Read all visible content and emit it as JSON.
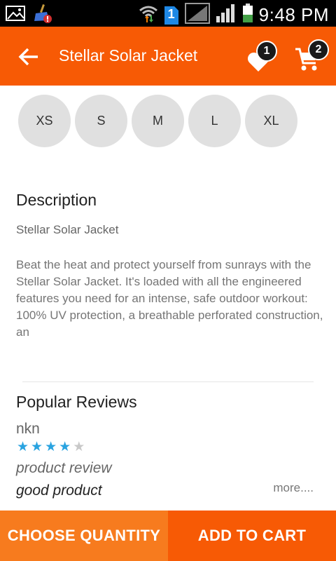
{
  "status_bar": {
    "time": "9:48 PM",
    "sim_badge": "1",
    "icons": [
      "image-icon",
      "broom-icon",
      "wifi-icon",
      "sim-icon",
      "signal-icon",
      "battery-icon"
    ]
  },
  "app_bar": {
    "title": "Stellar Solar Jacket",
    "wishlist_count": "1",
    "cart_count": "2",
    "accent_color": "#f75a05"
  },
  "sizes": [
    "XS",
    "S",
    "M",
    "L",
    "XL"
  ],
  "description": {
    "heading": "Description",
    "subtitle": "Stellar Solar Jacket",
    "body": "Beat the heat and protect yourself from sunrays with the Stellar Solar Jacket. It's loaded with all the engineered features you need for an intense, safe outdoor workout: 100% UV protection, a breathable perforated construction, an"
  },
  "reviews": {
    "heading": "Popular Reviews",
    "items": [
      {
        "reviewer": "nkn",
        "rating": 4,
        "max_rating": 5,
        "title": "product review",
        "body": "good product",
        "more_label": "more...."
      }
    ]
  },
  "actions": {
    "choose_quantity": "CHOOSE QUANTITY",
    "add_to_cart": "ADD TO CART"
  }
}
